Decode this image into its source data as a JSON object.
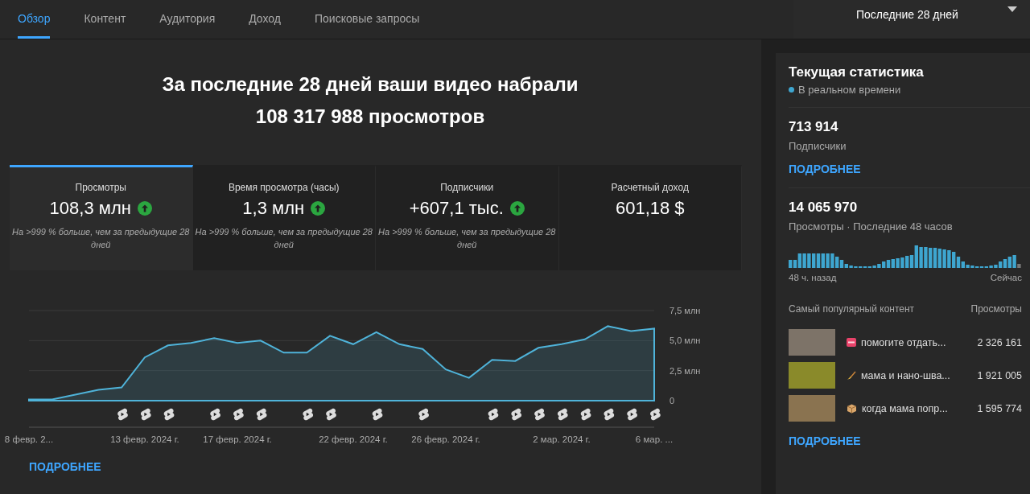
{
  "tabs": [
    {
      "label": "Обзор",
      "selected": true
    },
    {
      "label": "Контент",
      "selected": false
    },
    {
      "label": "Аудитория",
      "selected": false
    },
    {
      "label": "Доход",
      "selected": false
    },
    {
      "label": "Поисковые запросы",
      "selected": false
    }
  ],
  "date_range": {
    "label": "Последние 28 дней"
  },
  "headline": [
    "За последние 28 дней ваши видео набрали",
    "108 317 988 просмотров"
  ],
  "metrics": [
    {
      "label": "Просмотры",
      "value": "108,3 млн",
      "trend_up": true,
      "note": "На >999 % больше, чем за предыдущие 28 дней",
      "selected": true
    },
    {
      "label": "Время просмотра (часы)",
      "value": "1,3 млн",
      "trend_up": true,
      "note": "На >999 % больше, чем за предыдущие 28 дней",
      "selected": false
    },
    {
      "label": "Подписчики",
      "value": "+607,1 тыс.",
      "trend_up": true,
      "note": "На >999 % больше, чем за предыдущие 28 дней",
      "selected": false
    },
    {
      "label": "Расчетный доход",
      "value": "601,18 $",
      "trend_up": false,
      "selected": false
    }
  ],
  "chart_data": {
    "type": "area",
    "categories": [
      "8 февр. 2...",
      null,
      null,
      null,
      null,
      "13 февр. 2024 г.",
      null,
      null,
      null,
      "17 февр. 2024 г.",
      null,
      null,
      null,
      null,
      "22 февр. 2024 г.",
      null,
      null,
      null,
      "26 февр. 2024 г.",
      null,
      null,
      null,
      null,
      "2 мар. 2024 г.",
      null,
      null,
      null,
      "6 мар. ..."
    ],
    "series": [
      {
        "color": "#4fb3d9",
        "values": [
          0.1,
          0.1,
          0.5,
          0.9,
          1.1,
          3.6,
          4.6,
          4.8,
          5.2,
          4.8,
          5.0,
          4.0,
          4.0,
          5.4,
          4.7,
          5.7,
          4.7,
          4.3,
          2.6,
          1.9,
          3.4,
          3.3,
          4.4,
          4.7,
          5.1,
          6.2,
          5.8,
          6.0
        ]
      }
    ],
    "ylim": [
      0,
      7.5
    ],
    "yticks": [
      {
        "value": 0,
        "label": "0"
      },
      {
        "value": 2.5,
        "label": "2,5 млн"
      },
      {
        "value": 5,
        "label": "5,0 млн"
      },
      {
        "value": 7.5,
        "label": "7,5 млн"
      }
    ]
  },
  "upload_marks": [
    false,
    false,
    false,
    false,
    true,
    true,
    true,
    false,
    true,
    true,
    true,
    false,
    true,
    true,
    false,
    true,
    false,
    true,
    false,
    false,
    true,
    true,
    true,
    true,
    true,
    true,
    true,
    true
  ],
  "more_link": "ПОДРОБНЕЕ",
  "realtime": {
    "title": "Текущая статистика",
    "live_label": "В реальном времени",
    "subscribers": {
      "value": "713 914",
      "label": "Подписчики",
      "link": "ПОДРОБНЕЕ"
    },
    "views": {
      "value": "14 065 970",
      "label": "Просмотры · Последние 48 часов",
      "start_label": "48 ч. назад",
      "end_label": "Сейчас"
    },
    "top_header": [
      "Самый популярный контент",
      "Просмотры"
    ],
    "top_content": [
      {
        "title": "помогите отдать...",
        "views": "2 326 161",
        "kind": "sos",
        "color": "#7d7368"
      },
      {
        "title": "мама и нано-шва...",
        "views": "1 921 005",
        "kind": "broom",
        "color": "#8a8a2a"
      },
      {
        "title": "когда мама попр...",
        "views": "1 595 774",
        "kind": "box",
        "color": "#8a7350"
      }
    ],
    "link": "ПОДРОБНЕЕ"
  }
}
